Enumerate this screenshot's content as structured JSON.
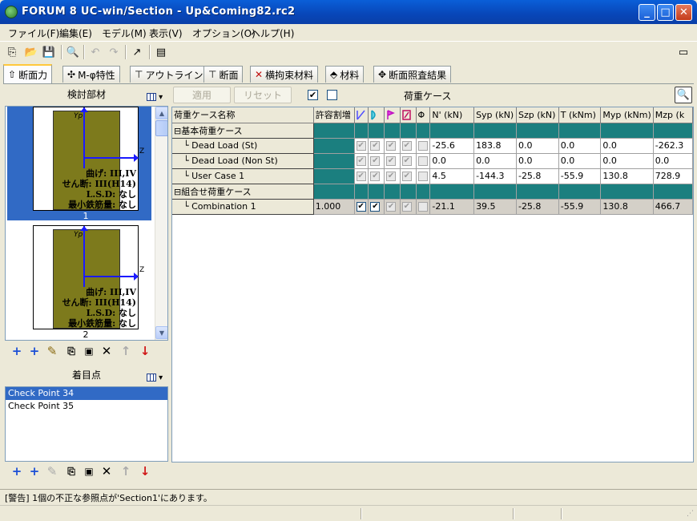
{
  "window": {
    "title": "FORUM 8  UC-win/Section - Up&Coming82.rc2",
    "min": "_",
    "max": "□",
    "close": "✕"
  },
  "menu": [
    "ファイル(F)",
    "編集(E)",
    "モデル(M)",
    "表示(V)",
    "オプション(O)",
    "ヘルプ(H)"
  ],
  "tabs": [
    "断面力",
    "M-φ特性",
    "アウトライン",
    "断面",
    "横拘束材料",
    "材料",
    "断面照査結果"
  ],
  "left": {
    "members_title": "検討部材",
    "sections": [
      {
        "number": "1",
        "yp": "Yp",
        "zp": "Z",
        "lines": [
          "曲げ: III,IV",
          "せん断: III(H14)",
          "L.S.D: なし",
          "最小鉄筋量: なし"
        ]
      },
      {
        "number": "2",
        "yp": "Yp",
        "zp": "Z",
        "lines": [
          "曲げ: III,IV",
          "せん断: III(H14)",
          "L.S.D: なし",
          "最小鉄筋量: なし"
        ]
      }
    ],
    "points_title": "着目点",
    "check_points": [
      "Check Point 34",
      "Check Point 35"
    ]
  },
  "right": {
    "apply_label": "適用",
    "reset_label": "リセット",
    "check_all": "✔",
    "title": "荷重ケース",
    "columns": [
      "荷重ケース名称",
      "許容割増",
      "",
      "",
      "",
      "",
      "Φ",
      "N' (kN)",
      "Syp (kN)",
      "Szp (kN)",
      "T (kNm)",
      "Myp (kNm)",
      "Mzp (k"
    ],
    "rows": [
      {
        "name": "基本荷重ケース",
        "group": true
      },
      {
        "name": "Dead Load (St)",
        "allow": "",
        "vals": [
          "-25.6",
          "183.8",
          "0.0",
          "0.0",
          "0.0",
          "-262.3"
        ]
      },
      {
        "name": "Dead Load (Non St)",
        "allow": "",
        "vals": [
          "0.0",
          "0.0",
          "0.0",
          "0.0",
          "0.0",
          "0.0"
        ]
      },
      {
        "name": "User Case 1",
        "allow": "",
        "vals": [
          "4.5",
          "-144.3",
          "-25.8",
          "-55.9",
          "130.8",
          "728.9"
        ]
      },
      {
        "name": "組合せ荷重ケース",
        "group": true
      },
      {
        "name": "Combination 1",
        "allow": "1.000",
        "vals": [
          "-21.1",
          "39.5",
          "-25.8",
          "-55.9",
          "130.8",
          "466.7"
        ]
      }
    ]
  },
  "status": {
    "message": "[警告] 1個の不正な参照点が'Section1'にあります。"
  }
}
